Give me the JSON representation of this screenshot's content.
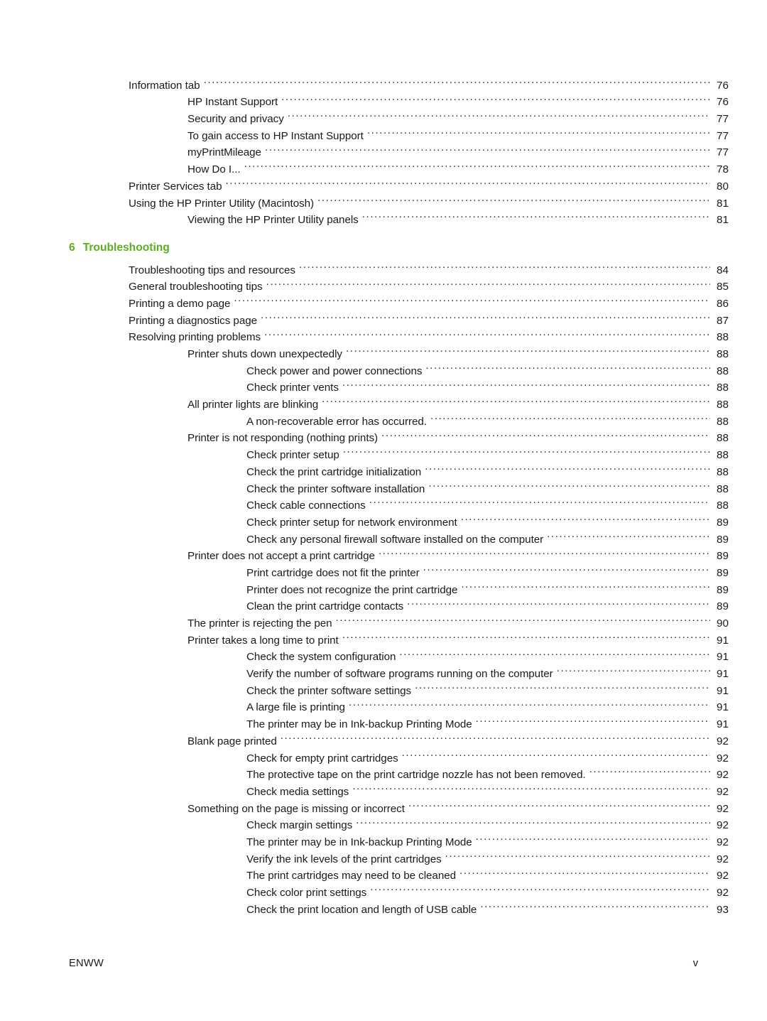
{
  "document": {
    "type": "table-of-contents",
    "page_label": "v",
    "footer_left": "ENWW",
    "heading_color": "#5aaf1e"
  },
  "toc": {
    "entries_before_chapter": [
      {
        "level": 1,
        "title": "Information tab",
        "page": "76"
      },
      {
        "level": 2,
        "title": "HP Instant Support",
        "page": "76"
      },
      {
        "level": 2,
        "title": "Security and privacy",
        "page": "77"
      },
      {
        "level": 2,
        "title": "To gain access to HP Instant Support",
        "page": "77"
      },
      {
        "level": 2,
        "title": "myPrintMileage",
        "page": "77"
      },
      {
        "level": 2,
        "title": "How Do I...",
        "page": "78"
      },
      {
        "level": 1,
        "title": "Printer Services tab",
        "page": "80"
      },
      {
        "level": 1,
        "title": "Using the HP Printer Utility (Macintosh)",
        "page": "81"
      },
      {
        "level": 2,
        "title": "Viewing the HP Printer Utility panels",
        "page": "81"
      }
    ],
    "chapter": {
      "number": "6",
      "title": "Troubleshooting"
    },
    "entries_after_chapter": [
      {
        "level": 1,
        "title": "Troubleshooting tips and resources",
        "page": "84"
      },
      {
        "level": 1,
        "title": "General troubleshooting tips",
        "page": "85"
      },
      {
        "level": 1,
        "title": "Printing a demo page",
        "page": "86"
      },
      {
        "level": 1,
        "title": "Printing a diagnostics page",
        "page": "87"
      },
      {
        "level": 1,
        "title": "Resolving printing problems",
        "page": "88"
      },
      {
        "level": 2,
        "title": "Printer shuts down unexpectedly",
        "page": "88"
      },
      {
        "level": 3,
        "title": "Check power and power connections",
        "page": "88"
      },
      {
        "level": 3,
        "title": "Check printer vents",
        "page": "88"
      },
      {
        "level": 2,
        "title": "All printer lights are blinking",
        "page": "88"
      },
      {
        "level": 3,
        "title": "A non-recoverable error has occurred.",
        "page": "88"
      },
      {
        "level": 2,
        "title": "Printer is not responding (nothing prints)",
        "page": "88"
      },
      {
        "level": 3,
        "title": "Check printer setup",
        "page": "88"
      },
      {
        "level": 3,
        "title": "Check the print cartridge initialization",
        "page": "88"
      },
      {
        "level": 3,
        "title": "Check the printer software installation",
        "page": "88"
      },
      {
        "level": 3,
        "title": "Check cable connections",
        "page": "88"
      },
      {
        "level": 3,
        "title": "Check printer setup for network environment",
        "page": "89"
      },
      {
        "level": 3,
        "title": "Check any personal firewall software installed on the computer",
        "page": "89"
      },
      {
        "level": 2,
        "title": "Printer does not accept a print cartridge",
        "page": "89"
      },
      {
        "level": 3,
        "title": "Print cartridge does not fit the printer",
        "page": "89"
      },
      {
        "level": 3,
        "title": "Printer does not recognize the print cartridge",
        "page": "89"
      },
      {
        "level": 3,
        "title": "Clean the print cartridge contacts",
        "page": "89"
      },
      {
        "level": 2,
        "title": "The printer is rejecting the pen",
        "page": "90"
      },
      {
        "level": 2,
        "title": "Printer takes a long time to print",
        "page": "91"
      },
      {
        "level": 3,
        "title": "Check the system configuration",
        "page": "91"
      },
      {
        "level": 3,
        "title": "Verify the number of software programs running on the computer",
        "page": "91"
      },
      {
        "level": 3,
        "title": "Check the printer software settings",
        "page": "91"
      },
      {
        "level": 3,
        "title": "A large file is printing",
        "page": "91"
      },
      {
        "level": 3,
        "title": "The printer may be in Ink-backup Printing Mode",
        "page": "91"
      },
      {
        "level": 2,
        "title": "Blank page printed",
        "page": "92"
      },
      {
        "level": 3,
        "title": "Check for empty print cartridges",
        "page": "92"
      },
      {
        "level": 3,
        "title": "The protective tape on the print cartridge nozzle has not been removed.",
        "page": "92"
      },
      {
        "level": 3,
        "title": "Check media settings",
        "page": "92"
      },
      {
        "level": 2,
        "title": "Something on the page is missing or incorrect",
        "page": "92"
      },
      {
        "level": 3,
        "title": "Check margin settings",
        "page": "92"
      },
      {
        "level": 3,
        "title": "The printer may be in Ink-backup Printing Mode",
        "page": "92"
      },
      {
        "level": 3,
        "title": "Verify the ink levels of the print cartridges",
        "page": "92"
      },
      {
        "level": 3,
        "title": "The print cartridges may need to be cleaned",
        "page": "92"
      },
      {
        "level": 3,
        "title": "Check color print settings",
        "page": "92"
      },
      {
        "level": 3,
        "title": "Check the print location and length of USB cable",
        "page": "93"
      }
    ]
  }
}
